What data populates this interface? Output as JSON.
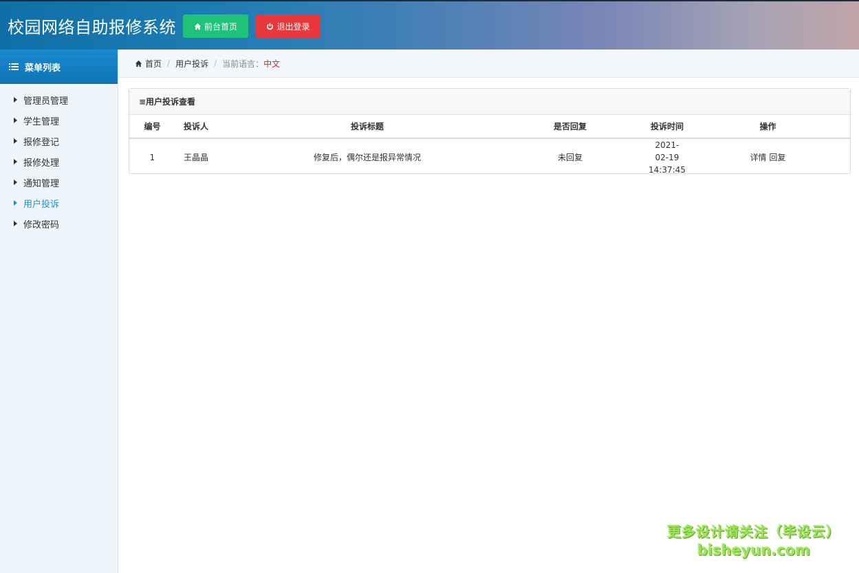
{
  "header": {
    "title": "校园网络自助报修系统",
    "home_button": "前台首页",
    "logout_button": "退出登录",
    "colors": {
      "home_button": "#1fc27b",
      "logout_button": "#e8383d"
    }
  },
  "sidebar": {
    "title": "菜单列表",
    "items": [
      {
        "label": "管理员管理",
        "active": false
      },
      {
        "label": "学生管理",
        "active": false
      },
      {
        "label": "报修登记",
        "active": false
      },
      {
        "label": "报修处理",
        "active": false
      },
      {
        "label": "通知管理",
        "active": false
      },
      {
        "label": "用户投诉",
        "active": true
      },
      {
        "label": "修改密码",
        "active": false
      }
    ]
  },
  "breadcrumb": {
    "home": "首页",
    "current": "用户投诉",
    "lang_label": "当前语言：",
    "lang_value": "中文"
  },
  "panel": {
    "title": "≡用户投诉查看",
    "columns": [
      "编号",
      "投诉人",
      "投诉标题",
      "是否回复",
      "投诉时间",
      "操作"
    ],
    "rows": [
      {
        "id": "1",
        "complainant": "王晶晶",
        "subject": "修复后，偶尔还是报异常情况",
        "replied": "未回复",
        "date": "2021-02-19",
        "time": "14:37:45",
        "action_detail": "详情",
        "action_reply": "回复"
      }
    ]
  },
  "watermark": {
    "line1": "更多设计请关注（毕设云）",
    "line2": "bisheyun.com"
  }
}
